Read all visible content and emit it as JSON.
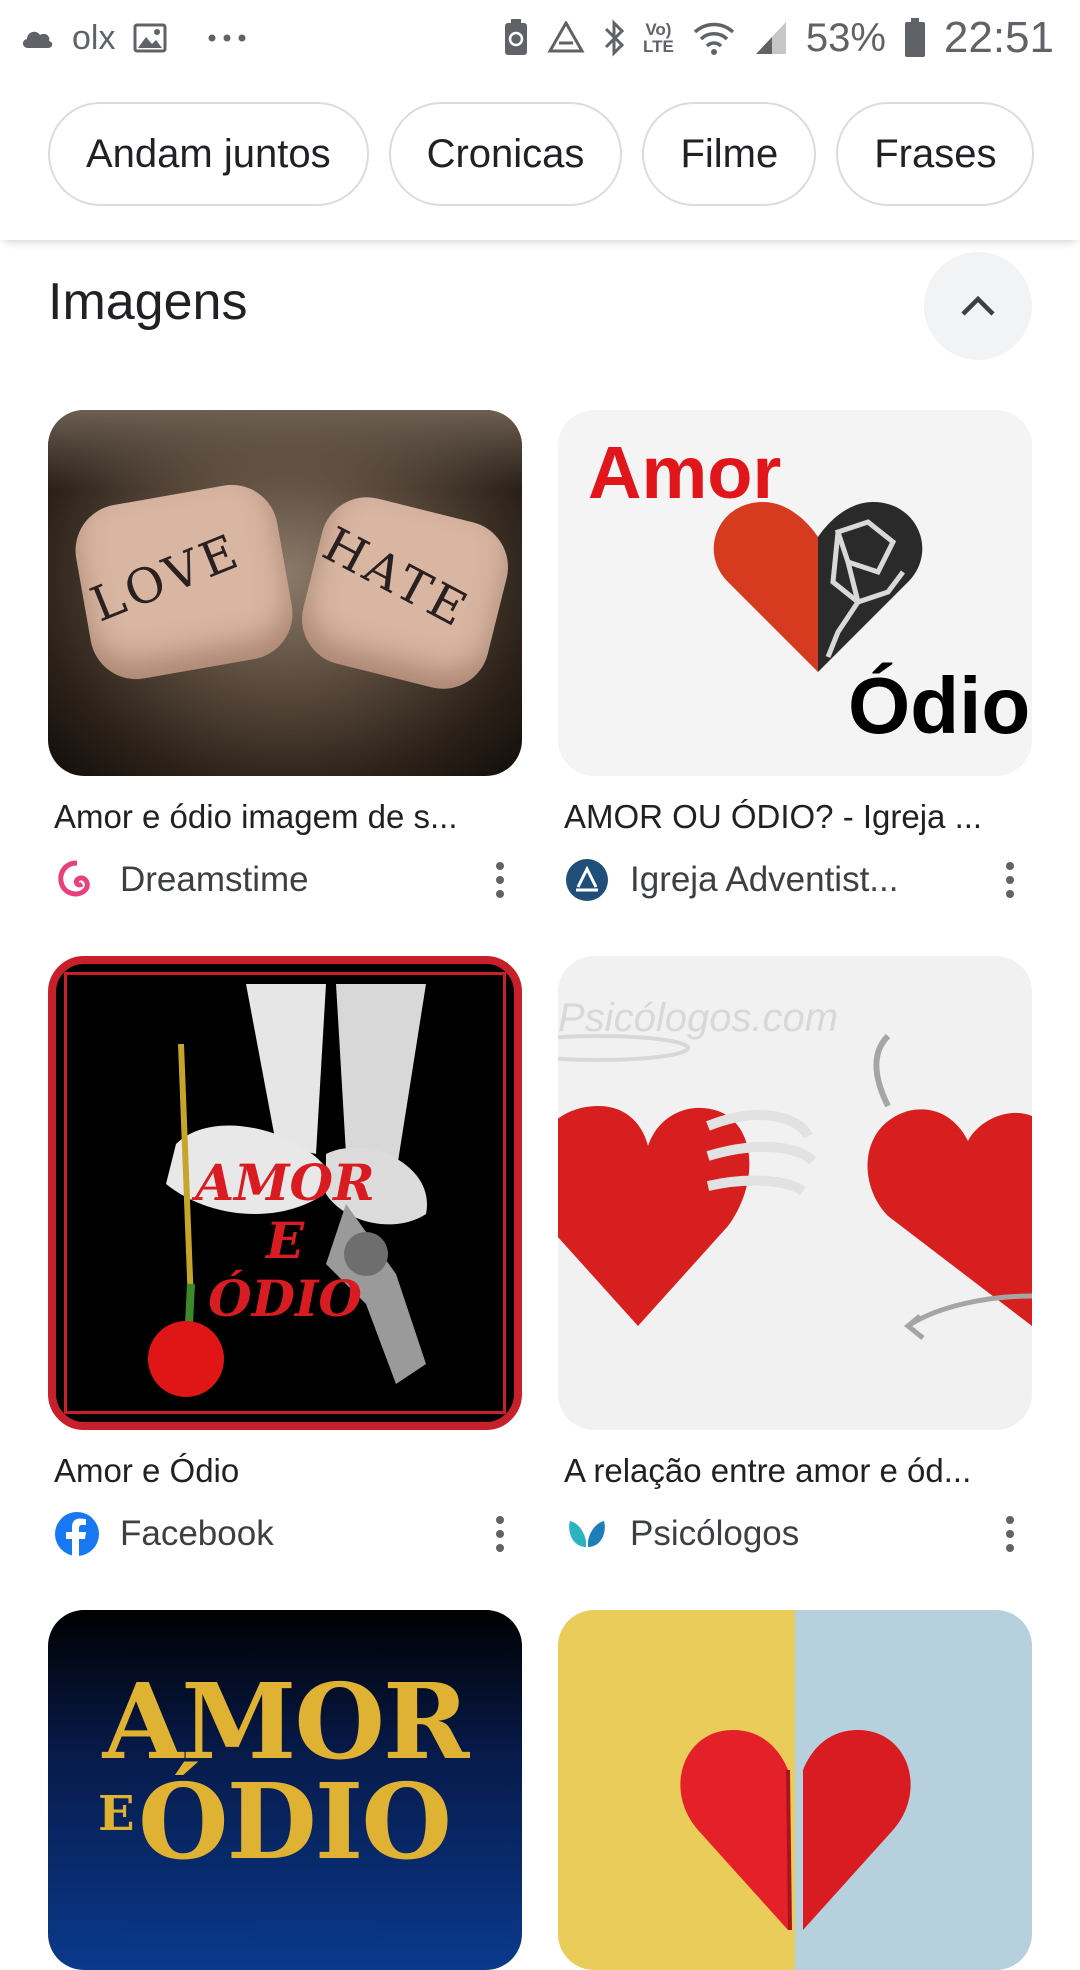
{
  "status_bar": {
    "left_text": "olx",
    "battery": "53%",
    "time": "22:51",
    "volte": "Vo) LTE"
  },
  "chips": [
    "Andam juntos",
    "Cronicas",
    "Filme",
    "Frases"
  ],
  "section": {
    "title": "Imagens"
  },
  "results": [
    {
      "caption": "Amor e ódio imagem de s...",
      "source": "Dreamstime",
      "image_text": [
        "LOVE",
        "HATE"
      ]
    },
    {
      "caption": "AMOR OU ÓDIO? - Igreja ...",
      "source": "Igreja Adventist...",
      "image_text": [
        "Amor",
        "Ódio"
      ]
    },
    {
      "caption": "Amor e Ódio",
      "source": "Facebook",
      "image_text": [
        "AMOR",
        "E",
        "ÓDIO"
      ]
    },
    {
      "caption": "A relação entre amor e ód...",
      "source": "Psicólogos",
      "image_text": [
        "Psicólogos.com"
      ]
    },
    {
      "image_text": [
        "AMOR",
        "E",
        "ÓDIO"
      ]
    },
    {
      "image_text": []
    }
  ],
  "colors": {
    "chip_border": "#dadce0",
    "text": "#202124",
    "secondary": "#5f6368",
    "button_bg": "#f1f3f4"
  },
  "icons": {
    "status_left": [
      "cloud-icon",
      "olx-icon",
      "image-icon",
      "more-notifications-icon"
    ],
    "status_right": [
      "nfc-icon",
      "recycle-icon",
      "bluetooth-icon",
      "volte-icon",
      "wifi-icon",
      "signal-icon",
      "battery-icon"
    ],
    "collapse": "chevron-up-icon",
    "overflow": "more-vert-icon"
  }
}
